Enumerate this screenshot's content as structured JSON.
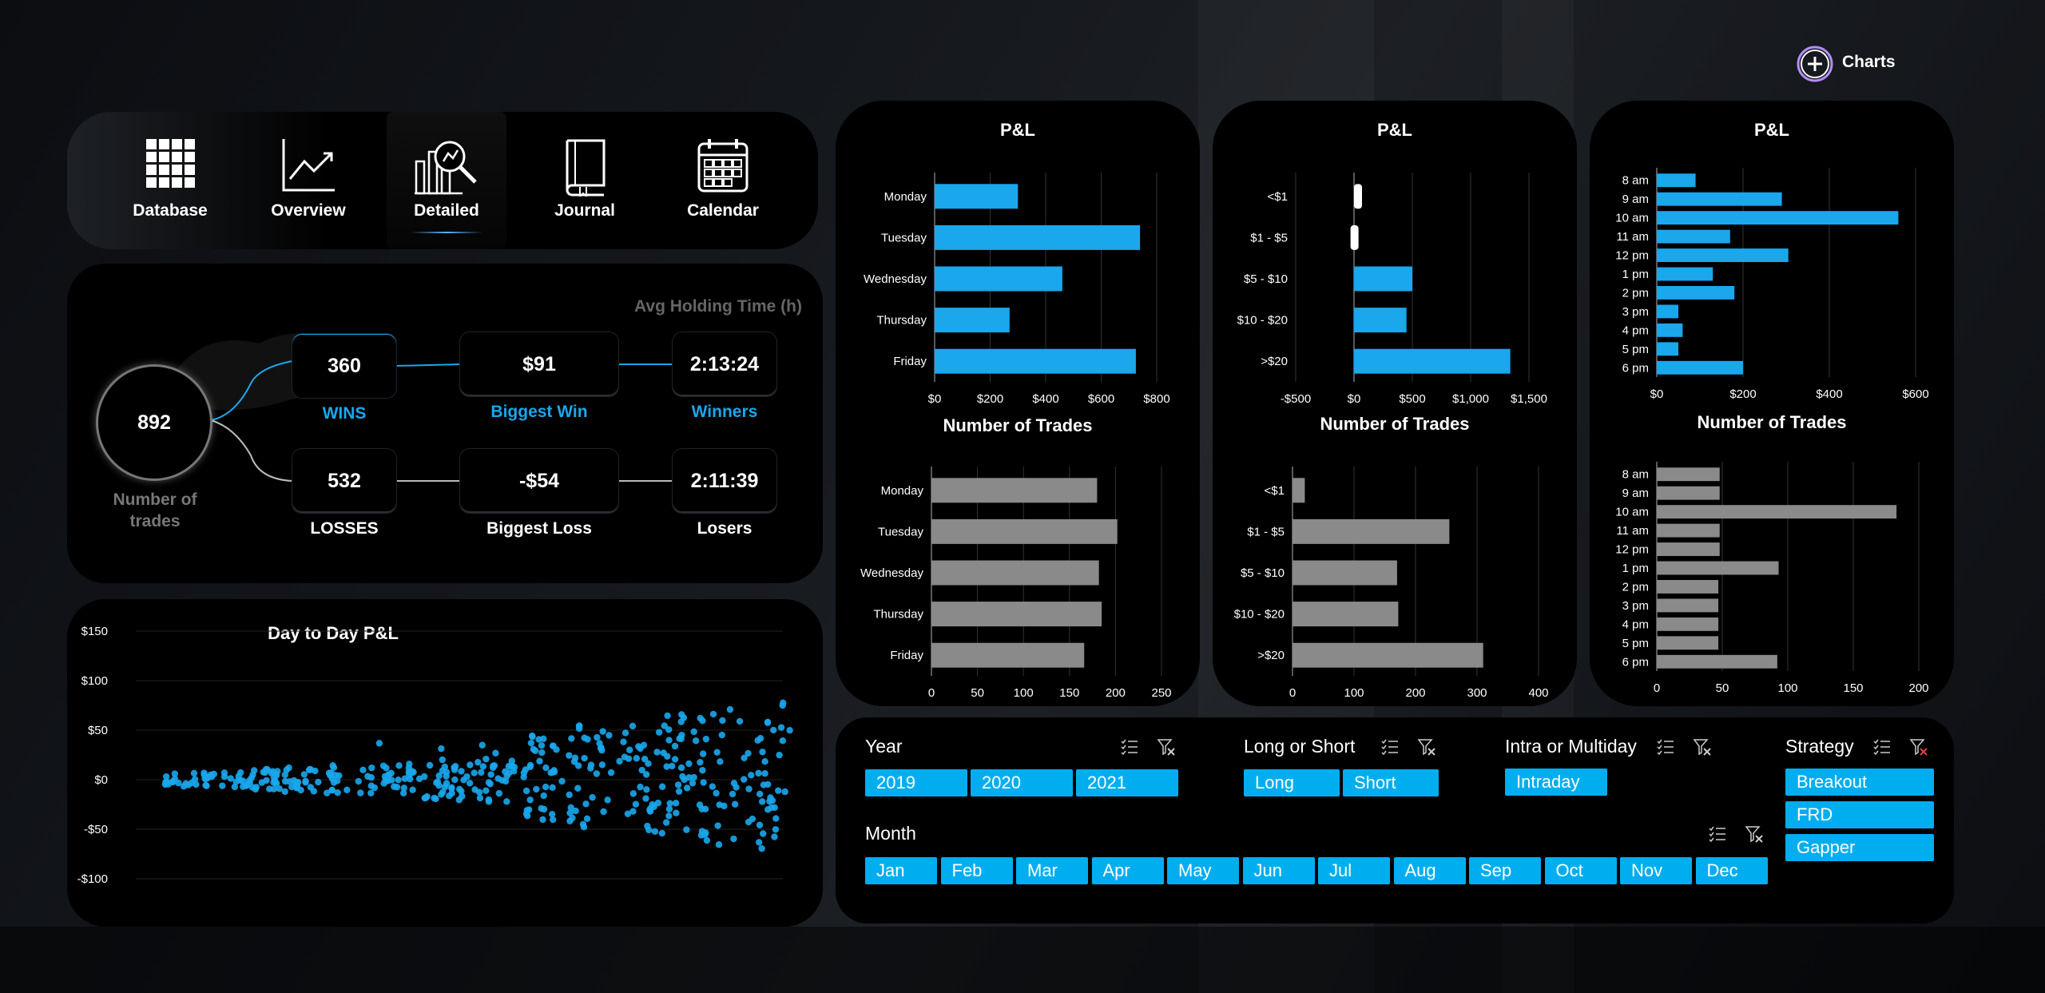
{
  "header": {
    "charts_label": "Charts"
  },
  "nav": [
    {
      "label": "Database",
      "icon": "grid-icon"
    },
    {
      "label": "Overview",
      "icon": "line-chart-icon"
    },
    {
      "label": "Detailed",
      "icon": "magnifier-chart-icon",
      "active": true
    },
    {
      "label": "Journal",
      "icon": "book-icon"
    },
    {
      "label": "Calendar",
      "icon": "calendar-icon"
    }
  ],
  "stats": {
    "trades_count": "892",
    "trades_label": "Number of trades",
    "wins": "360",
    "wins_label": "WINS",
    "losses": "532",
    "losses_label": "LOSSES",
    "biggest_win": "$91",
    "biggest_win_label": "Biggest Win",
    "biggest_loss": "-$54",
    "biggest_loss_label": "Biggest Loss",
    "avg_hold_header": "Avg Holding Time (h)",
    "winners_time": "2:13:24",
    "winners_label": "Winners",
    "losers_time": "2:11:39",
    "losers_label": "Losers"
  },
  "colors": {
    "accent": "#1aa7ec",
    "chip": "#00aeef",
    "gray_bar": "#8a8a8a",
    "bg": "#000000"
  },
  "chart_data": [
    {
      "type": "scatter",
      "title": "Day to Day P&L",
      "ylim": [
        -100,
        150
      ],
      "y_ticks": [
        "$150",
        "$100",
        "$50",
        "$0",
        "-$50",
        "-$100"
      ],
      "series": [
        {
          "name": "",
          "color": "#1aa7ec",
          "points_count": 440
        }
      ]
    },
    {
      "type": "bar",
      "orientation": "horizontal",
      "title": "P&L",
      "categories": [
        "Monday",
        "Tuesday",
        "Wednesday",
        "Thursday",
        "Friday"
      ],
      "values": [
        300,
        740,
        460,
        270,
        725
      ],
      "xlim": [
        0,
        800
      ],
      "x_ticks": [
        "$0",
        "$200",
        "$400",
        "$600",
        "$800"
      ],
      "color": "#1aa7ec"
    },
    {
      "type": "bar",
      "orientation": "horizontal",
      "title": "P&L",
      "categories": [
        "<$1",
        "$1 - $5",
        "$5 - $10",
        "$10 - $20",
        ">$20"
      ],
      "values": [
        15,
        -30,
        500,
        450,
        1340
      ],
      "xlim": [
        -500,
        1500
      ],
      "x_ticks": [
        "-$500",
        "$0",
        "$500",
        "$1,000",
        "$1,500"
      ],
      "color": "#1aa7ec"
    },
    {
      "type": "bar",
      "orientation": "horizontal",
      "title": "P&L",
      "categories": [
        "8 am",
        "9 am",
        "10 am",
        "11 am",
        "12 pm",
        "1 pm",
        "2 pm",
        "3 pm",
        "4 pm",
        "5 pm",
        "6 pm"
      ],
      "values": [
        90,
        290,
        560,
        170,
        305,
        130,
        180,
        50,
        60,
        50,
        200
      ],
      "xlim": [
        0,
        600
      ],
      "x_ticks": [
        "$0",
        "$200",
        "$400",
        "$600"
      ],
      "color": "#1aa7ec"
    },
    {
      "type": "bar",
      "orientation": "horizontal",
      "title": "Number of Trades",
      "categories": [
        "Monday",
        "Tuesday",
        "Wednesday",
        "Thursday",
        "Friday"
      ],
      "values": [
        180,
        202,
        182,
        185,
        166
      ],
      "xlim": [
        0,
        250
      ],
      "x_ticks": [
        "0",
        "50",
        "100",
        "150",
        "200",
        "250"
      ],
      "color": "#8a8a8a"
    },
    {
      "type": "bar",
      "orientation": "horizontal",
      "title": "Number of Trades",
      "categories": [
        "<$1",
        "$1 - $5",
        "$5 - $10",
        "$10 - $20",
        ">$20"
      ],
      "values": [
        20,
        255,
        170,
        172,
        310
      ],
      "xlim": [
        0,
        400
      ],
      "x_ticks": [
        "0",
        "100",
        "200",
        "300",
        "400"
      ],
      "color": "#8a8a8a"
    },
    {
      "type": "bar",
      "orientation": "horizontal",
      "title": "Number of Trades",
      "categories": [
        "8 am",
        "9 am",
        "10 am",
        "11 am",
        "12 pm",
        "1 pm",
        "2 pm",
        "3 pm",
        "4 pm",
        "5 pm",
        "6 pm"
      ],
      "values": [
        48,
        48,
        183,
        48,
        48,
        93,
        47,
        47,
        47,
        47,
        92
      ],
      "xlim": [
        0,
        200
      ],
      "x_ticks": [
        "0",
        "50",
        "100",
        "150",
        "200"
      ],
      "color": "#8a8a8a"
    }
  ],
  "filters": {
    "year": {
      "title": "Year",
      "options": [
        "2019",
        "2020",
        "2021"
      ]
    },
    "long_short": {
      "title": "Long or Short",
      "options": [
        "Long",
        "Short"
      ]
    },
    "intra": {
      "title": "Intra or Multiday",
      "options": [
        "Intraday"
      ]
    },
    "strategy": {
      "title": "Strategy",
      "options": [
        "Breakout",
        "FRD",
        "Gapper"
      ]
    },
    "month": {
      "title": "Month",
      "options": [
        "Jan",
        "Feb",
        "Mar",
        "Apr",
        "May",
        "Jun",
        "Jul",
        "Aug",
        "Sep",
        "Oct",
        "Nov",
        "Dec"
      ]
    }
  }
}
